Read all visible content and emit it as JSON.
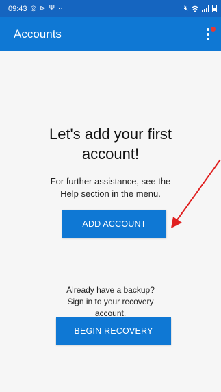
{
  "status_bar": {
    "time": "09:43",
    "left_icons": [
      "whatsapp-icon",
      "play-icon",
      "usb-icon",
      "more-notifications-icon"
    ],
    "right_icons": [
      "mute-icon",
      "wifi-icon",
      "signal-icon",
      "battery-icon"
    ]
  },
  "app_bar": {
    "title": "Accounts",
    "menu_icon": "overflow-menu-icon",
    "badge_color": "#e53935"
  },
  "empty_state": {
    "headline": "Let's add your first account!",
    "help_text": "For further assistance, see the Help section in the menu.",
    "add_button_label": "ADD ACCOUNT",
    "backup_text": "Already have a backup? Sign in to your recovery account.",
    "recovery_button_label": "BEGIN RECOVERY"
  },
  "annotation": {
    "arrow_color": "#e02020"
  },
  "colors": {
    "status_bar": "#1565c0",
    "app_bar": "#0f78d4",
    "button": "#0f78d4",
    "background": "#f6f6f6"
  }
}
